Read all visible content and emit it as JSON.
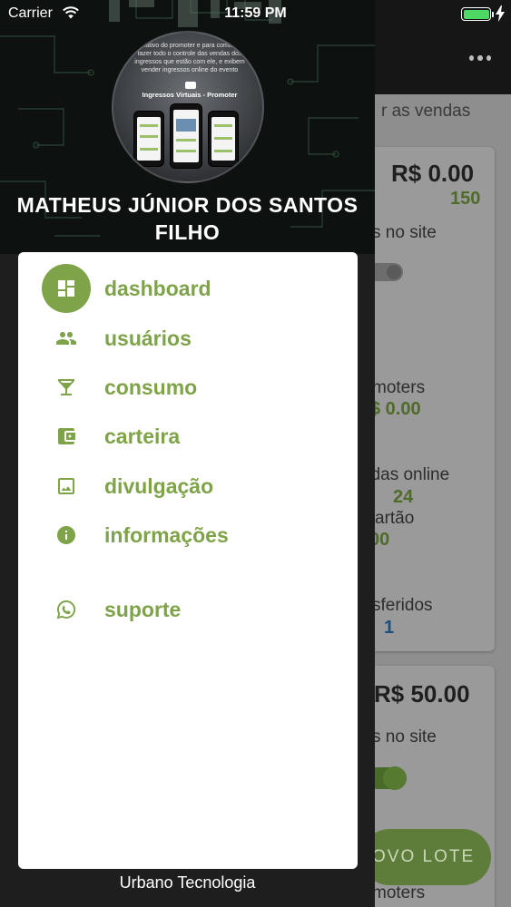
{
  "status_bar": {
    "carrier": "Carrier",
    "time": "11:59 PM",
    "battery_color": "#4cd964"
  },
  "drawer": {
    "header": {
      "blurb": "aplicativo do promoter e para comissário fazer todo o controle das vendas dos ingressos que estão com ele, e exibem vender ingressos online do evento",
      "brand": "Ingressos Virtuais - Promoter"
    },
    "user_name": "MATHEUS JÚNIOR DOS SANTOS FILHO",
    "menu": [
      {
        "label": "dashboard",
        "icon": "dashboard-icon",
        "active": true
      },
      {
        "label": "usuários",
        "icon": "users-icon",
        "active": false
      },
      {
        "label": "consumo",
        "icon": "cocktail-icon",
        "active": false
      },
      {
        "label": "carteira",
        "icon": "wallet-icon",
        "active": false
      },
      {
        "label": "divulgação",
        "icon": "image-icon",
        "active": false
      },
      {
        "label": "informações",
        "icon": "info-icon",
        "active": false
      },
      {
        "label": "suporte",
        "icon": "whatsapp-icon",
        "active": false
      }
    ],
    "footer": "Urbano Tecnologia",
    "accent_color": "#7ea348"
  },
  "background_page": {
    "subtitle": "r as vendas",
    "card1": {
      "price": "R$ 0.00",
      "count": "150",
      "site_label": "s no site",
      "promoters_label": "moters",
      "promoters_value": "$ 0.00",
      "online_label": "ndas online",
      "online_value": "24",
      "card_label": "artão",
      "card_value": "00",
      "transfer_label": "sferidos",
      "transfer_value": "1"
    },
    "card2": {
      "price": "R$ 50.00",
      "site_label": "s no site",
      "promoters_label": "moters"
    },
    "fab_label": "OVO LOTE"
  }
}
